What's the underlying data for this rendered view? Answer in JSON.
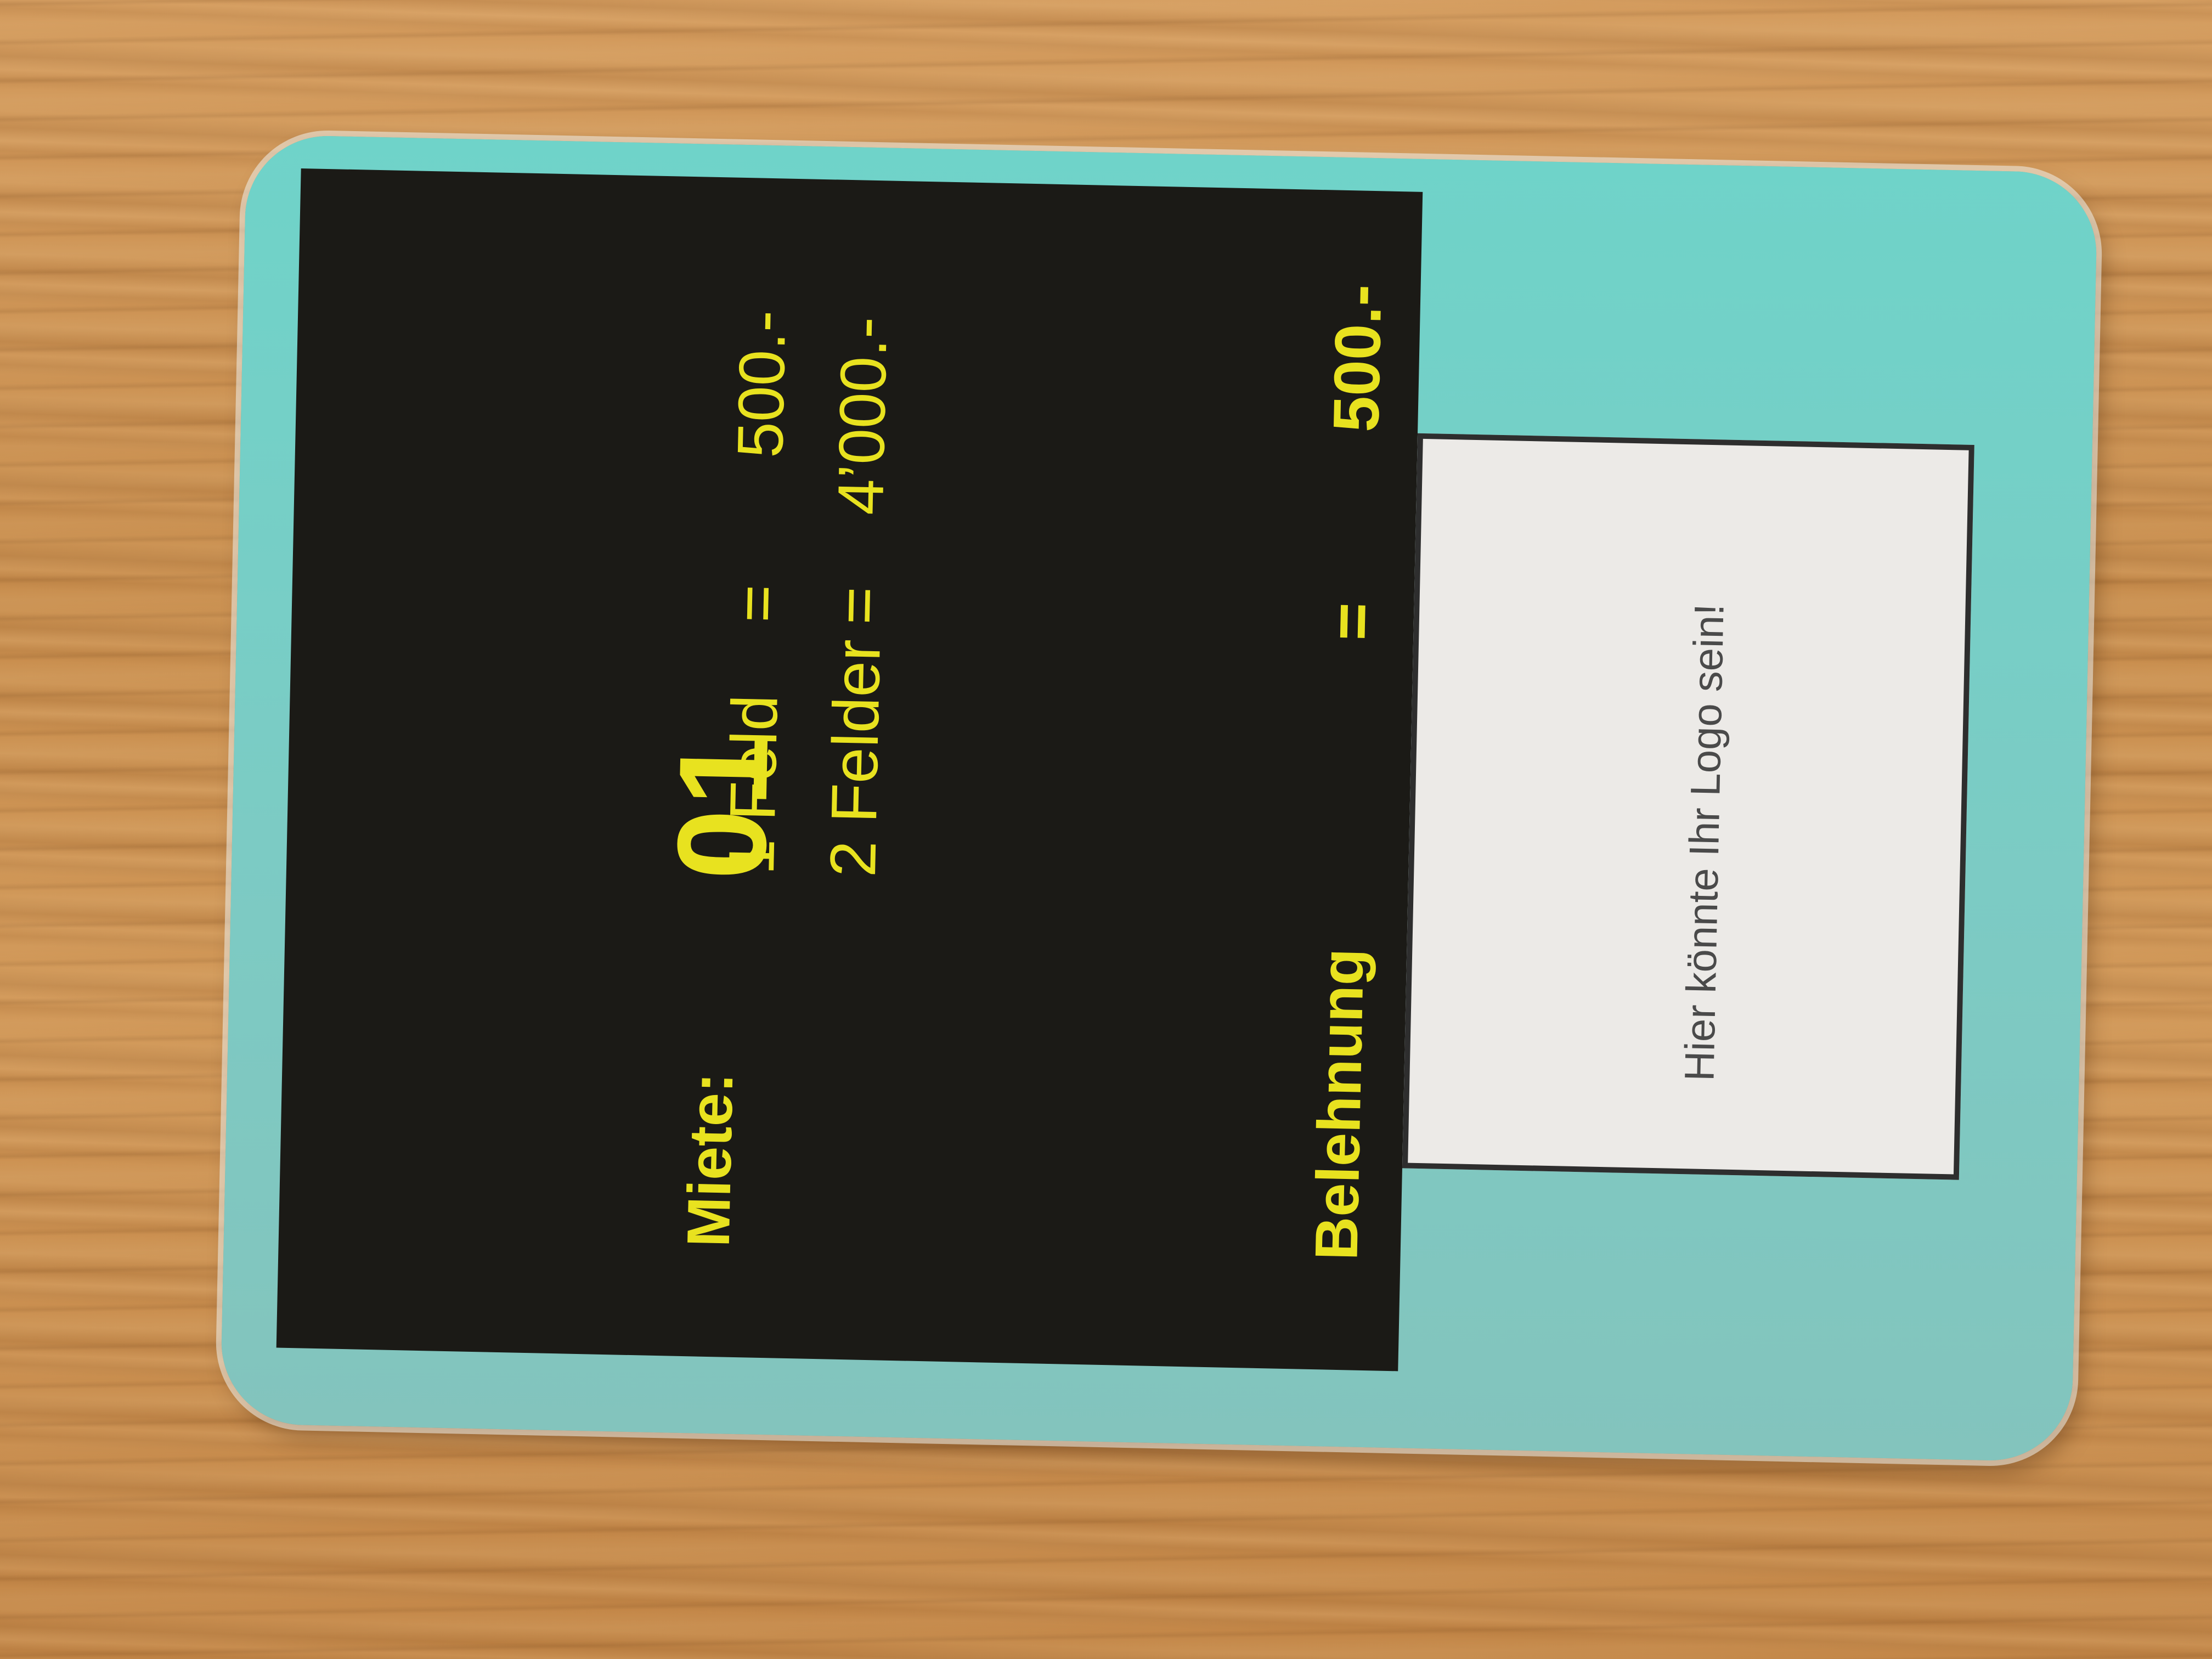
{
  "card": {
    "number": "01",
    "rent_label": "Miete:",
    "rent_rows": [
      {
        "name": "1 Feld",
        "equals": "=",
        "value": "500.-"
      },
      {
        "name": "2 Felder",
        "equals": "=",
        "value": "4’000.-"
      }
    ],
    "loan": {
      "label": "Belehnung",
      "equals": "=",
      "value": "500.-"
    },
    "logo_placeholder": "Hier könnte Ihr Logo sein!"
  },
  "colors": {
    "card_background": "#7ccbc4",
    "panel": "#1b1a16",
    "text_accent": "#e8e21f",
    "logo_box": "#eceae7",
    "table_wood": "#c98f4f"
  }
}
